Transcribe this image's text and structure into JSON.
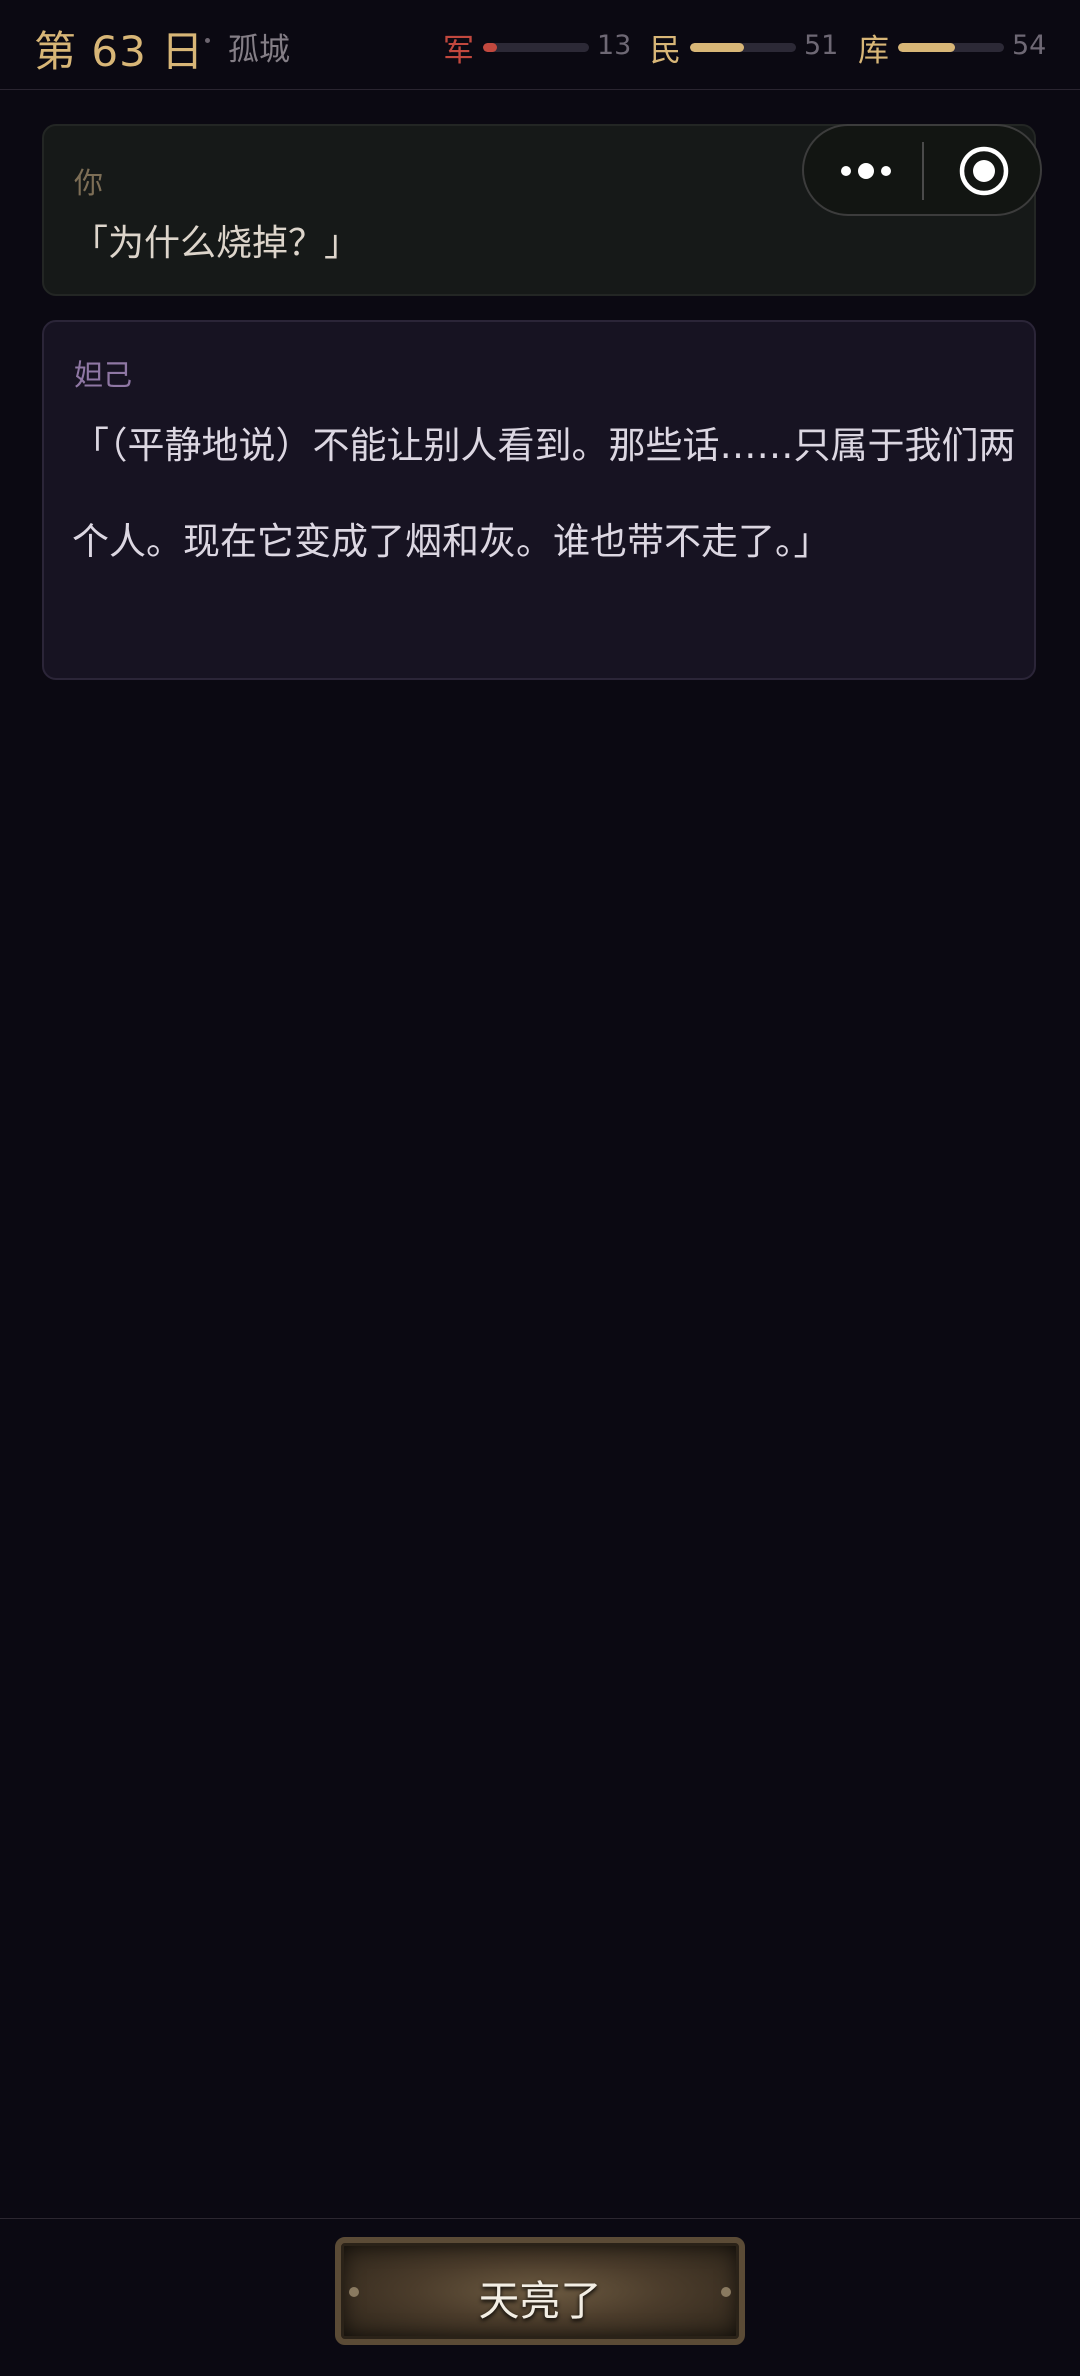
{
  "header": {
    "day_prefix": "第",
    "day_number": "63",
    "day_suffix": "日",
    "location": "孤城",
    "stats": [
      {
        "label": "军",
        "value": "13",
        "level": 0.13,
        "color": "#c2483e"
      },
      {
        "label": "民",
        "value": "51",
        "level": 0.51,
        "color": "#d8b677"
      },
      {
        "label": "库",
        "value": "54",
        "level": 0.54,
        "color": "#d8b677"
      }
    ]
  },
  "capsule": {
    "more_icon": "more-dots-icon",
    "close_icon": "target-icon"
  },
  "dialogue": [
    {
      "speaker": "你",
      "text": "「为什么烧掉？」"
    },
    {
      "speaker": "妲己",
      "text": "「（平静地说）不能让别人看到。那些话……只属于我们两个人。现在它变成了烟和灰。谁也带不走了。」"
    }
  ],
  "footer": {
    "button_label": "天亮了"
  },
  "colors": {
    "background": "#0b0912",
    "gold": "#d8b677",
    "army": "#c2483e"
  }
}
